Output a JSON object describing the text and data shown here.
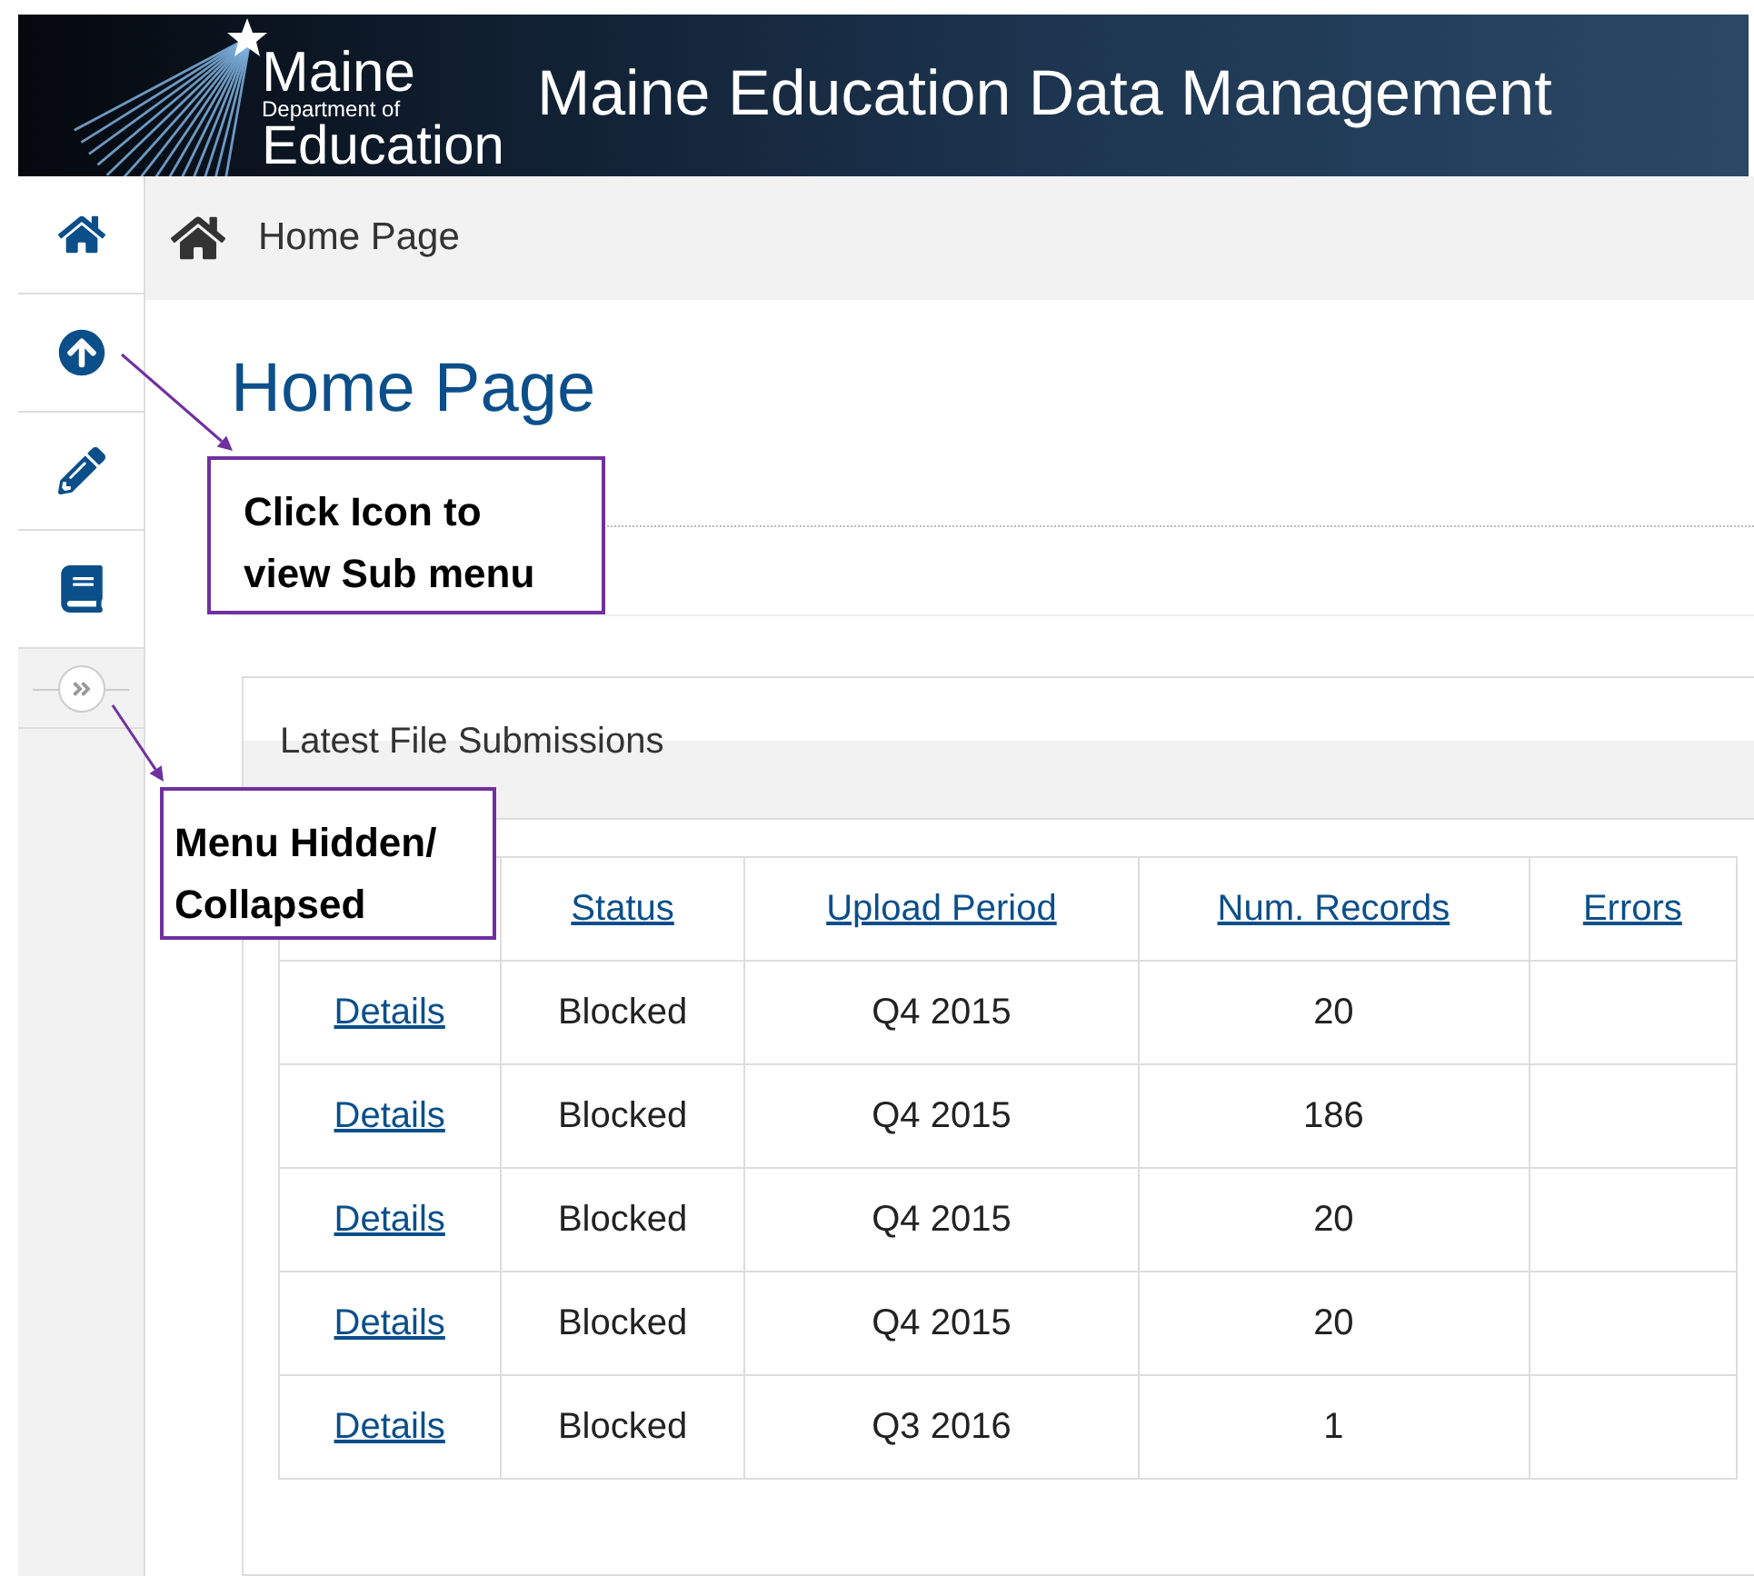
{
  "header": {
    "logo_lines": [
      "Maine",
      "Department of",
      "Education"
    ],
    "title": "Maine Education Data Management"
  },
  "breadcrumb": {
    "label": "Home Page"
  },
  "page_title": "Home Page",
  "panel": {
    "title": "Latest File Submissions"
  },
  "table": {
    "columns": [
      "Status",
      "Upload Period",
      "Num. Records",
      "Errors"
    ],
    "rows": [
      {
        "link": "Details",
        "status": "Blocked",
        "upload_period": "Q4 2015",
        "num_records": "20"
      },
      {
        "link": "Details",
        "status": "Blocked",
        "upload_period": "Q4 2015",
        "num_records": "186"
      },
      {
        "link": "Details",
        "status": "Blocked",
        "upload_period": "Q4 2015",
        "num_records": "20"
      },
      {
        "link": "Details",
        "status": "Blocked",
        "upload_period": "Q4 2015",
        "num_records": "20"
      },
      {
        "link": "Details",
        "status": "Blocked",
        "upload_period": "Q3 2016",
        "num_records": "1"
      }
    ]
  },
  "callouts": [
    {
      "text": "Click Icon to\nview Sub menu"
    },
    {
      "text": "Menu Hidden/\nCollapsed"
    }
  ]
}
